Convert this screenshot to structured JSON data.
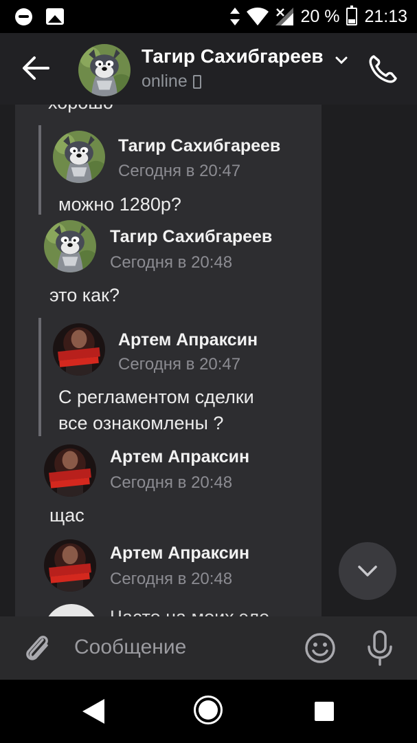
{
  "status_bar": {
    "battery": "20 %",
    "time": "21:13"
  },
  "header": {
    "title": "Тагир Сахибгареев",
    "status": "online"
  },
  "chat": {
    "cut_text": "хорошо",
    "messages": [
      {
        "name": "Тагир Сахибгареев",
        "time": "Сегодня в 20:47",
        "text": "можно 1280р?",
        "quoted": true,
        "avatar": "tom-cat-avatar"
      },
      {
        "name": "Тагир Сахибгареев",
        "time": "Сегодня в 20:48",
        "text": "это как?",
        "quoted": false,
        "avatar": "tom-cat-avatar"
      },
      {
        "name": "Артем Апраксин",
        "time": "Сегодня в 20:47",
        "text_lines": [
          "С регламентом сделки",
          "все ознакомлены ?"
        ],
        "quoted": true,
        "avatar": "artem-logo-avatar"
      },
      {
        "name": "Артем Апраксин",
        "time": "Сегодня в 20:48",
        "text": "щас",
        "quoted": false,
        "avatar": "artem-logo-avatar"
      },
      {
        "name": "Артем Апраксин",
        "time": "Сегодня в 20:48",
        "quoted": false,
        "avatar": "artem-logo-avatar"
      }
    ],
    "next_text_partial": "Часто на моих эле"
  },
  "composer": {
    "placeholder": "Сообщение"
  },
  "avatar_logo_text": {
    "line1": "АРТЕМ",
    "line2": "АПРАКСИН"
  },
  "colors": {
    "background": "#1e1e20",
    "message_column": "#2d2d30",
    "header": "#212124",
    "muted_text": "#8c8c92"
  }
}
